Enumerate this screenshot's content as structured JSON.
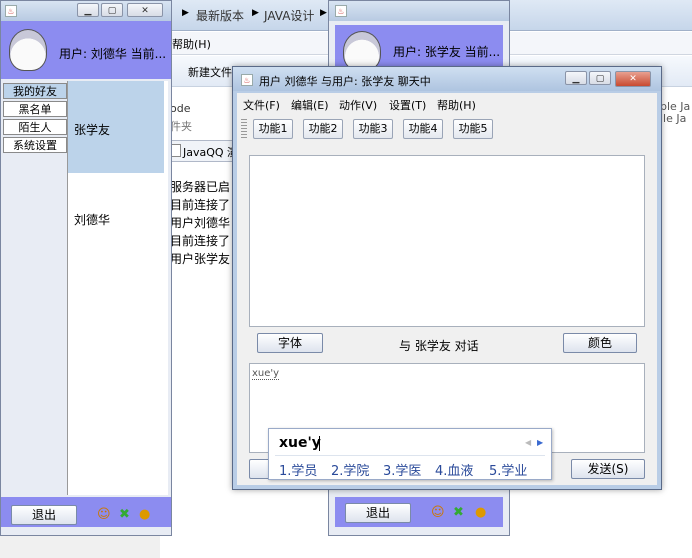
{
  "background_window": {
    "breadcrumb": [
      "最新版本",
      "JAVA设计"
    ],
    "menu": "帮助(H)",
    "new_file_button": "新建文件",
    "file_col_partial": "ode",
    "file_col_partial2": "件夹",
    "tab_label": "JavaQQ 演",
    "right_partial": "ple Ja",
    "right_partial2": "lle Ja",
    "log_lines": [
      "服务器已启",
      "目前连接了",
      "用户刘德华",
      "目前连接了",
      "用户张学友"
    ]
  },
  "client_left": {
    "user_label": "用户: 刘德华 当前...",
    "tabs": [
      "我的好友",
      "黑名单",
      "陌生人",
      "系统设置"
    ],
    "friends": [
      "张学友",
      "刘德华"
    ],
    "exit_button": "退出",
    "colors": {
      "header_bg": "#8c8cf0",
      "list_selected": "#bcd3ea",
      "bottom_bg": "#8c8cf0"
    }
  },
  "client_right": {
    "user_label": "用户: 张学友 当前...",
    "exit_button": "退出"
  },
  "chat_window": {
    "title": "用户 刘德华 与用户: 张学友 聊天中",
    "menu": [
      "文件(F)",
      "编辑(E)",
      "动作(V)",
      "设置(T)",
      "帮助(H)"
    ],
    "toolbar": [
      "功能1",
      "功能2",
      "功能3",
      "功能4",
      "功能5"
    ],
    "font_button": "字体",
    "conversation_label": "与 张学友 对话",
    "color_button": "颜色",
    "input_text": "xue'y",
    "send_button": "发送(S)"
  },
  "ime": {
    "composition": "xue'y",
    "candidates": [
      "1.学员",
      "2.学院",
      "3.学医",
      "4.血液",
      "5.学业"
    ]
  }
}
